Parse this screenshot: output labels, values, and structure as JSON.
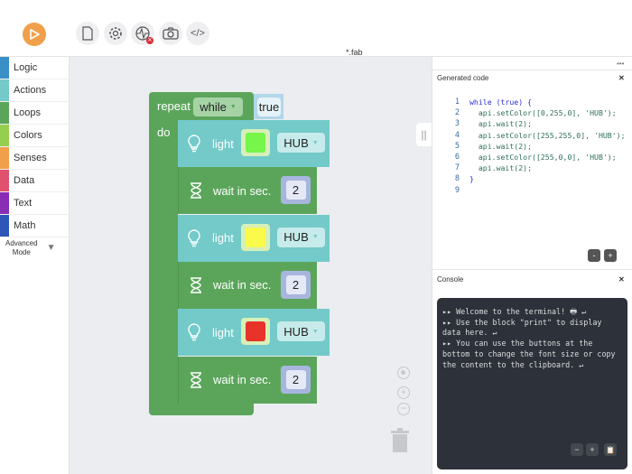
{
  "toolbar": {
    "file_name": "*.fab",
    "buttons": [
      "play-icon",
      "file-icon",
      "gear-icon",
      "pulse-icon",
      "camera-icon",
      "code-icon"
    ]
  },
  "sidebar": {
    "categories": [
      {
        "label": "Logic",
        "color": "#3a8fc7"
      },
      {
        "label": "Actions",
        "color": "#73cac9"
      },
      {
        "label": "Loops",
        "color": "#5ba55b"
      },
      {
        "label": "Colors",
        "color": "#96cf4f"
      },
      {
        "label": "Senses",
        "color": "#f0a04b"
      },
      {
        "label": "Data",
        "color": "#e0516d"
      },
      {
        "label": "Text",
        "color": "#8a2db5"
      },
      {
        "label": "Math",
        "color": "#2e56b8"
      }
    ],
    "advanced_line1": "Advanced",
    "advanced_line2": "Mode"
  },
  "blocks": {
    "repeat": "repeat",
    "mode": "while",
    "cond": "true",
    "do": "do",
    "items": [
      {
        "type": "light",
        "label": "light",
        "color": "#76f54a",
        "target": "HUB"
      },
      {
        "type": "wait",
        "label": "wait in sec.",
        "value": "2"
      },
      {
        "type": "light",
        "label": "light",
        "color": "#fafa4a",
        "target": "HUB"
      },
      {
        "type": "wait",
        "label": "wait in sec.",
        "value": "2"
      },
      {
        "type": "light",
        "label": "light",
        "color": "#e8332a",
        "target": "HUB"
      },
      {
        "type": "wait",
        "label": "wait in sec.",
        "value": "2"
      }
    ]
  },
  "code_panel": {
    "title": "Generated code",
    "menu": "•••",
    "close": "✕",
    "minus": "-",
    "plus": "+",
    "lines": [
      "while (true) {",
      "  api.setColor([0,255,0], 'HUB');",
      "  api.wait(2);",
      "  api.setColor([255,255,0], 'HUB');",
      "  api.wait(2);",
      "  api.setColor([255,0,0], 'HUB');",
      "  api.wait(2);",
      "}",
      ""
    ]
  },
  "console": {
    "title": "Console",
    "close": "✕",
    "text": "▸▸ Welcome to the terminal! 🖶 ↵\n▸▸ Use the block \"print\" to display data here. ↵\n▸▸ You can use the buttons at the bottom to change the font size or copy the content to the clipboard. ↵",
    "minus": "−",
    "plus": "+",
    "copy": "📋"
  }
}
